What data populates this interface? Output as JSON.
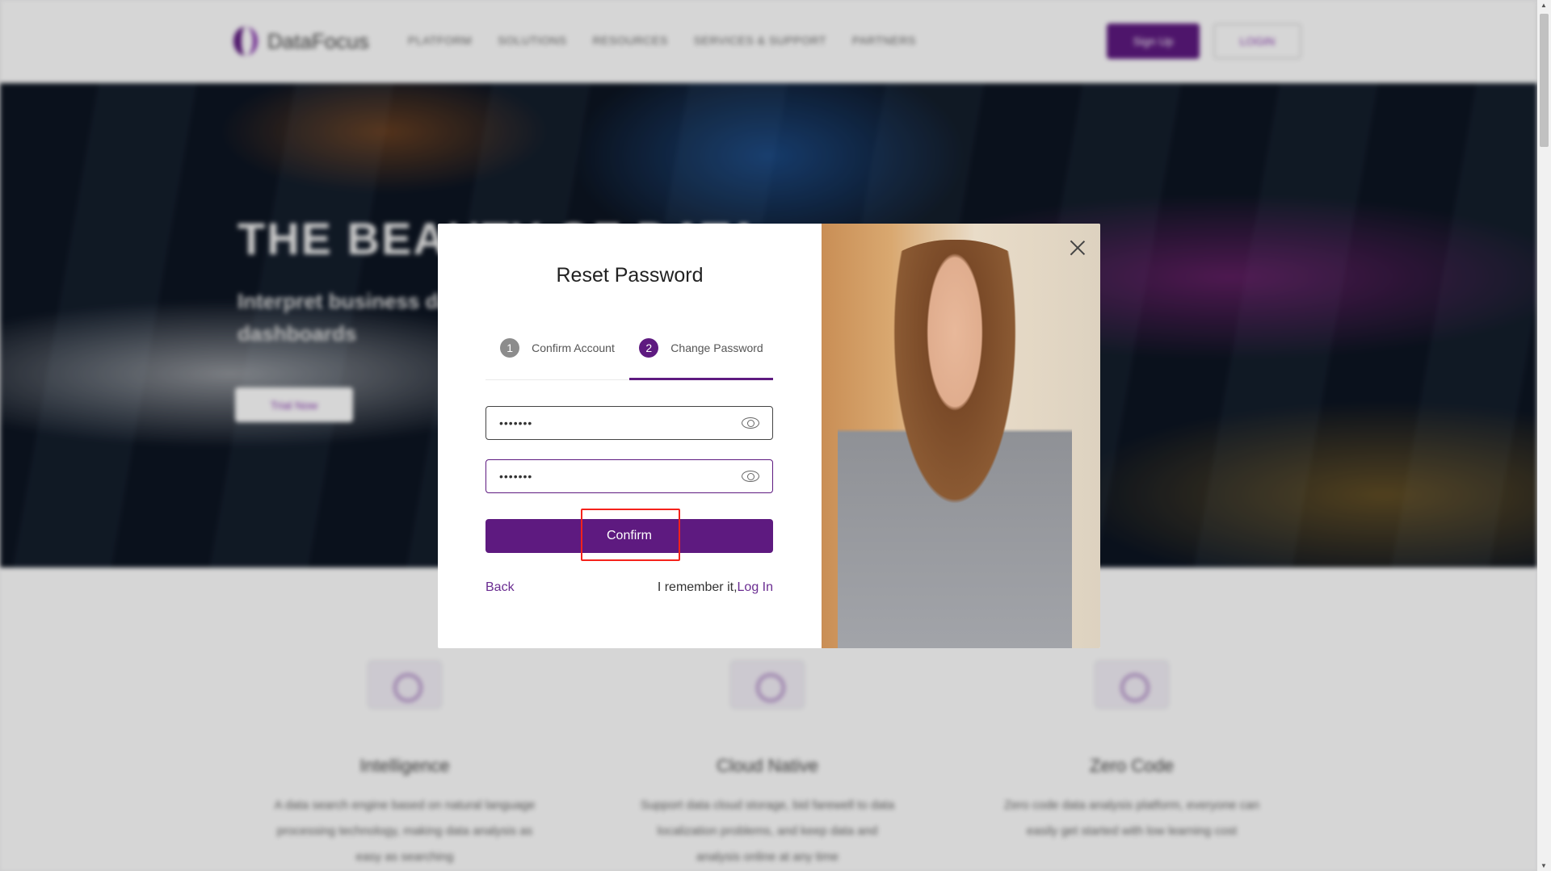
{
  "header": {
    "brand": "DataFocus",
    "nav": [
      "PLATFORM",
      "SOLUTIONS",
      "RESOURCES",
      "SERVICES & SUPPORT",
      "PARTNERS"
    ],
    "signup": "Sign Up",
    "login": "LOGIN"
  },
  "hero": {
    "title": "THE BEAUTY OF DATA",
    "subtitle_line1": "Interpret business data",
    "subtitle_line2": "dashboards",
    "cta": "Trial Now"
  },
  "features": [
    {
      "icon": "search-icon",
      "title": "Intelligence",
      "desc": "A data search engine based on natural language processing technology, making data analysis as easy as searching"
    },
    {
      "icon": "rocket-icon",
      "title": "Cloud Native",
      "desc": "Support data cloud storage, bid farewell to data localization problems, and keep data and analysis online at any time"
    },
    {
      "icon": "chart-icon",
      "title": "Zero Code",
      "desc": "Zero code data analysis platform, everyone can easily get started with low learning cost"
    }
  ],
  "modal": {
    "title": "Reset Password",
    "steps": [
      {
        "num": "1",
        "label": "Confirm Account",
        "active": false
      },
      {
        "num": "2",
        "label": "Change Password",
        "active": true
      }
    ],
    "password": "•••••••",
    "confirm_password": "•••••••",
    "confirm": "Confirm",
    "back": "Back",
    "remember": "I remember it,",
    "login": "Log In"
  },
  "colors": {
    "accent": "#5e1a80",
    "link": "#6a2c91",
    "highlight": "#f5221b"
  }
}
